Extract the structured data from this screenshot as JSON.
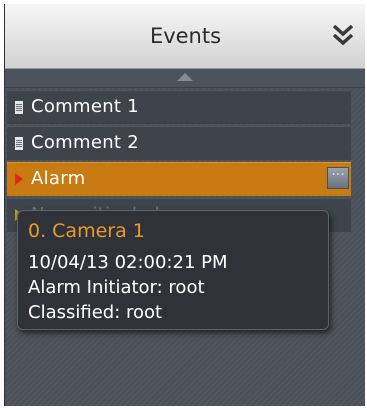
{
  "panel": {
    "title": "Events",
    "collapse_icon": "chevron-double-down-icon"
  },
  "events": [
    {
      "label": "Comment 1",
      "icon": "note-icon"
    },
    {
      "label": "Comment 2",
      "icon": "note-icon"
    },
    {
      "label": "Alarm",
      "icon": "arrow-right-icon",
      "selected": true,
      "action_icon": "message-icon"
    },
    {
      "label": "Non-critical alarm",
      "icon": "arrow-right-icon"
    }
  ],
  "tooltip": {
    "title": "0. Camera 1",
    "timestamp": "10/04/13 02:00:21 PM",
    "initiator": "Alarm Initiator: root",
    "classified": "Classified: root"
  },
  "colors": {
    "selected_row": "#c87b12",
    "tooltip_title": "#e89a2a",
    "alarm_arrow": "#e2261b"
  }
}
